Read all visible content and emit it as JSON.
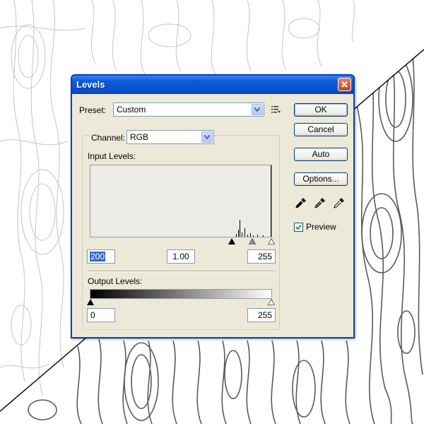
{
  "dialog": {
    "title": "Levels"
  },
  "preset": {
    "label": "Preset:",
    "value": "Custom"
  },
  "channel": {
    "label": "Channel:",
    "value": "RGB"
  },
  "input_levels": {
    "label": "Input Levels:",
    "black": "200",
    "gamma": "1.00",
    "white": "255"
  },
  "output_levels": {
    "label": "Output Levels:",
    "black": "0",
    "white": "255"
  },
  "buttons": {
    "ok": "OK",
    "cancel": "Cancel",
    "auto": "Auto",
    "options": "Options..."
  },
  "preview": {
    "label": "Preview",
    "checked": true
  },
  "icons": {
    "close": "close-icon",
    "preset_menu": "preset-menu-icon",
    "black_eyedropper": "black-eyedropper-icon",
    "gray_eyedropper": "gray-eyedropper-icon",
    "white_eyedropper": "white-eyedropper-icon"
  },
  "colors": {
    "title_bar": "#0a4fcc",
    "dialog_bg": "#ece9d8",
    "selection": "#316ac5"
  }
}
